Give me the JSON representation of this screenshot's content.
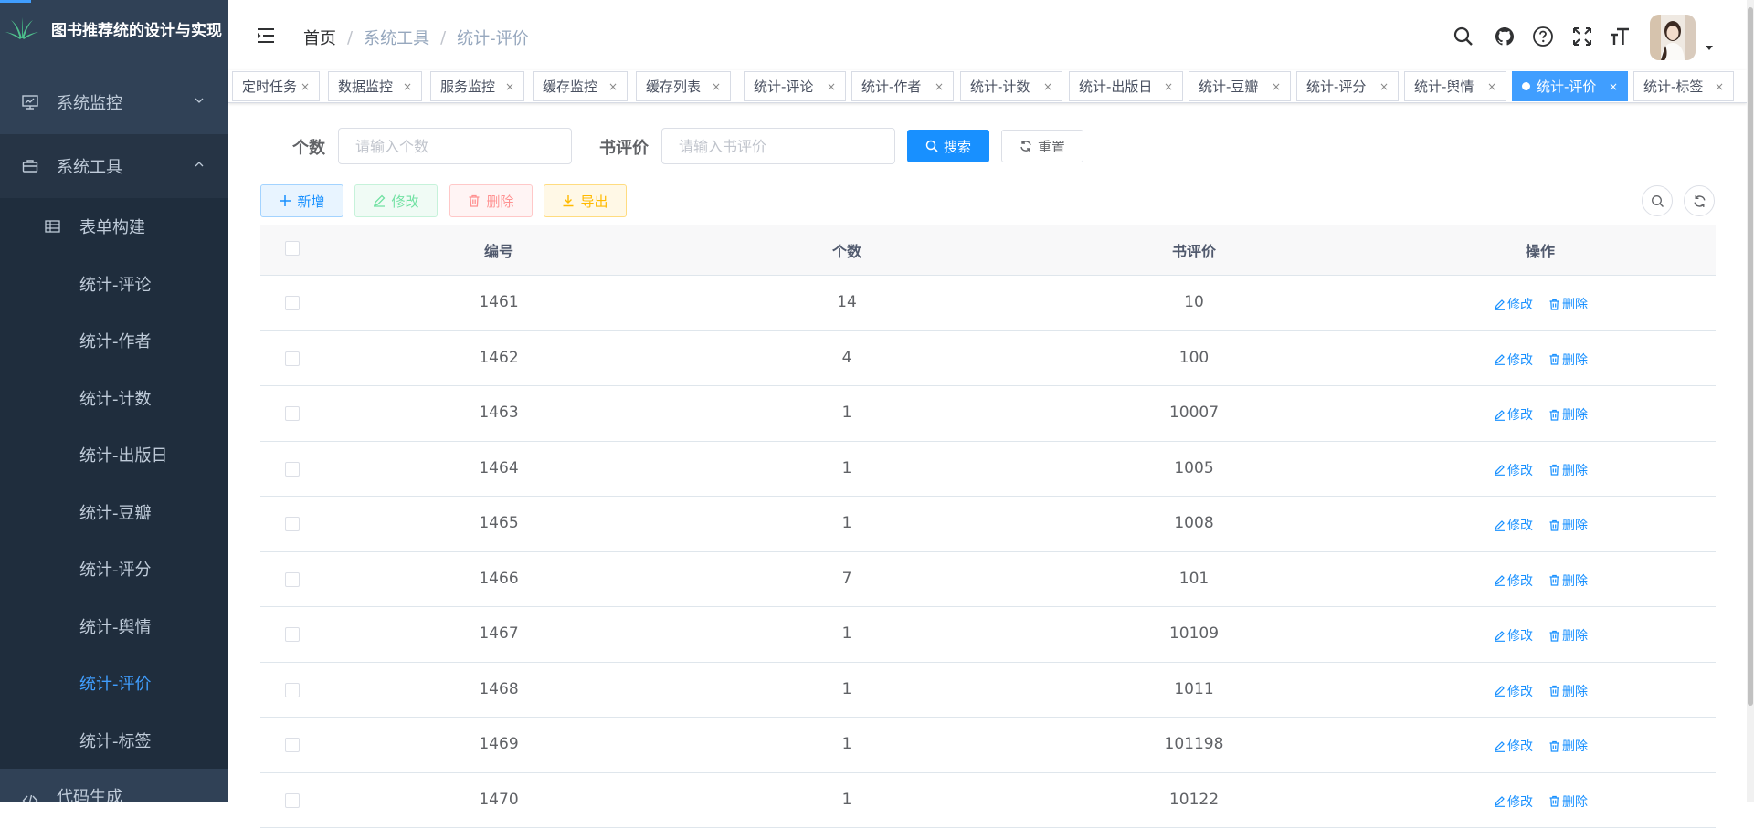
{
  "app": {
    "title": "图书推荐统的设计与实现"
  },
  "colors": {
    "primary": "#1890ff",
    "sidebar": "#304156",
    "sidebar_active_text": "#409eff"
  },
  "sidebar": {
    "items": [
      {
        "label": "系统监控",
        "icon": "monitor-icon",
        "expanded": false
      },
      {
        "label": "系统工具",
        "icon": "toolbox-icon",
        "expanded": true
      },
      {
        "label": "代码生成",
        "icon": "code-icon",
        "expanded": false
      }
    ],
    "submenu": [
      {
        "label": "表单构建",
        "icon": "table-icon"
      },
      {
        "label": "统计-评论"
      },
      {
        "label": "统计-作者"
      },
      {
        "label": "统计-计数"
      },
      {
        "label": "统计-出版日"
      },
      {
        "label": "统计-豆瓣"
      },
      {
        "label": "统计-评分"
      },
      {
        "label": "统计-舆情"
      },
      {
        "label": "统计-评价",
        "active": true
      },
      {
        "label": "统计-标签"
      }
    ]
  },
  "breadcrumb": {
    "home": "首页",
    "parent": "系统工具",
    "current": "统计-评价",
    "separator": "/"
  },
  "tags": [
    {
      "label": "定时任务"
    },
    {
      "label": "数据监控"
    },
    {
      "label": "服务监控"
    },
    {
      "label": "缓存监控"
    },
    {
      "label": "缓存列表"
    },
    {
      "label": "统计-评论"
    },
    {
      "label": "统计-作者"
    },
    {
      "label": "统计-计数"
    },
    {
      "label": "统计-出版日"
    },
    {
      "label": "统计-豆瓣"
    },
    {
      "label": "统计-评分"
    },
    {
      "label": "统计-舆情"
    },
    {
      "label": "统计-评价",
      "active": true
    },
    {
      "label": "统计-标签"
    }
  ],
  "tag_close": "×",
  "search": {
    "count_label": "个数",
    "count_placeholder": "请输入个数",
    "review_label": "书评价",
    "review_placeholder": "请输入书评价",
    "search_button": "搜索",
    "reset_button": "重置"
  },
  "toolbar": {
    "add": "新增",
    "edit": "修改",
    "delete": "删除",
    "export": "导出"
  },
  "table": {
    "columns": [
      "编号",
      "个数",
      "书评价",
      "操作"
    ],
    "actions": {
      "edit": "修改",
      "delete": "删除"
    },
    "rows": [
      {
        "id": "1461",
        "count": "14",
        "review": "10"
      },
      {
        "id": "1462",
        "count": "4",
        "review": "100"
      },
      {
        "id": "1463",
        "count": "1",
        "review": "10007"
      },
      {
        "id": "1464",
        "count": "1",
        "review": "1005"
      },
      {
        "id": "1465",
        "count": "1",
        "review": "1008"
      },
      {
        "id": "1466",
        "count": "7",
        "review": "101"
      },
      {
        "id": "1467",
        "count": "1",
        "review": "10109"
      },
      {
        "id": "1468",
        "count": "1",
        "review": "1011"
      },
      {
        "id": "1469",
        "count": "1",
        "review": "101198"
      },
      {
        "id": "1470",
        "count": "1",
        "review": "10122"
      }
    ]
  }
}
